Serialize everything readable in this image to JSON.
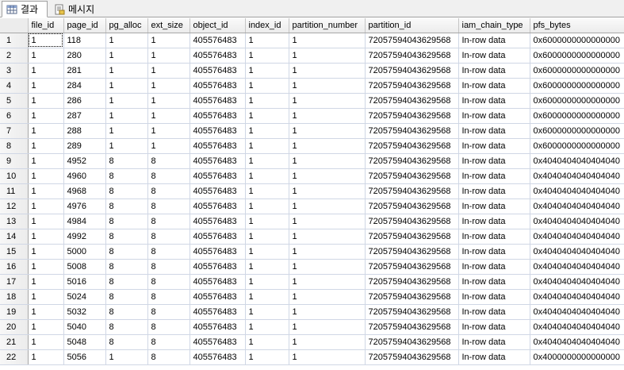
{
  "tabs": [
    {
      "label": "결과",
      "icon": "grid-results-icon",
      "active": true
    },
    {
      "label": "메시지",
      "icon": "messages-icon",
      "active": false
    }
  ],
  "columns": [
    "file_id",
    "page_id",
    "pg_alloc",
    "ext_size",
    "object_id",
    "index_id",
    "partition_number",
    "partition_id",
    "iam_chain_type",
    "pfs_bytes"
  ],
  "rows": [
    {
      "n": "1",
      "cells": [
        "1",
        "118",
        "1",
        "1",
        "405576483",
        "1",
        "1",
        "72057594043629568",
        "In-row data",
        "0x6000000000000000"
      ]
    },
    {
      "n": "2",
      "cells": [
        "1",
        "280",
        "1",
        "1",
        "405576483",
        "1",
        "1",
        "72057594043629568",
        "In-row data",
        "0x6000000000000000"
      ]
    },
    {
      "n": "3",
      "cells": [
        "1",
        "281",
        "1",
        "1",
        "405576483",
        "1",
        "1",
        "72057594043629568",
        "In-row data",
        "0x6000000000000000"
      ]
    },
    {
      "n": "4",
      "cells": [
        "1",
        "284",
        "1",
        "1",
        "405576483",
        "1",
        "1",
        "72057594043629568",
        "In-row data",
        "0x6000000000000000"
      ]
    },
    {
      "n": "5",
      "cells": [
        "1",
        "286",
        "1",
        "1",
        "405576483",
        "1",
        "1",
        "72057594043629568",
        "In-row data",
        "0x6000000000000000"
      ]
    },
    {
      "n": "6",
      "cells": [
        "1",
        "287",
        "1",
        "1",
        "405576483",
        "1",
        "1",
        "72057594043629568",
        "In-row data",
        "0x6000000000000000"
      ]
    },
    {
      "n": "7",
      "cells": [
        "1",
        "288",
        "1",
        "1",
        "405576483",
        "1",
        "1",
        "72057594043629568",
        "In-row data",
        "0x6000000000000000"
      ]
    },
    {
      "n": "8",
      "cells": [
        "1",
        "289",
        "1",
        "1",
        "405576483",
        "1",
        "1",
        "72057594043629568",
        "In-row data",
        "0x6000000000000000"
      ]
    },
    {
      "n": "9",
      "cells": [
        "1",
        "4952",
        "8",
        "8",
        "405576483",
        "1",
        "1",
        "72057594043629568",
        "In-row data",
        "0x4040404040404040"
      ]
    },
    {
      "n": "10",
      "cells": [
        "1",
        "4960",
        "8",
        "8",
        "405576483",
        "1",
        "1",
        "72057594043629568",
        "In-row data",
        "0x4040404040404040"
      ]
    },
    {
      "n": "11",
      "cells": [
        "1",
        "4968",
        "8",
        "8",
        "405576483",
        "1",
        "1",
        "72057594043629568",
        "In-row data",
        "0x4040404040404040"
      ]
    },
    {
      "n": "12",
      "cells": [
        "1",
        "4976",
        "8",
        "8",
        "405576483",
        "1",
        "1",
        "72057594043629568",
        "In-row data",
        "0x4040404040404040"
      ]
    },
    {
      "n": "13",
      "cells": [
        "1",
        "4984",
        "8",
        "8",
        "405576483",
        "1",
        "1",
        "72057594043629568",
        "In-row data",
        "0x4040404040404040"
      ]
    },
    {
      "n": "14",
      "cells": [
        "1",
        "4992",
        "8",
        "8",
        "405576483",
        "1",
        "1",
        "72057594043629568",
        "In-row data",
        "0x4040404040404040"
      ]
    },
    {
      "n": "15",
      "cells": [
        "1",
        "5000",
        "8",
        "8",
        "405576483",
        "1",
        "1",
        "72057594043629568",
        "In-row data",
        "0x4040404040404040"
      ]
    },
    {
      "n": "16",
      "cells": [
        "1",
        "5008",
        "8",
        "8",
        "405576483",
        "1",
        "1",
        "72057594043629568",
        "In-row data",
        "0x4040404040404040"
      ]
    },
    {
      "n": "17",
      "cells": [
        "1",
        "5016",
        "8",
        "8",
        "405576483",
        "1",
        "1",
        "72057594043629568",
        "In-row data",
        "0x4040404040404040"
      ]
    },
    {
      "n": "18",
      "cells": [
        "1",
        "5024",
        "8",
        "8",
        "405576483",
        "1",
        "1",
        "72057594043629568",
        "In-row data",
        "0x4040404040404040"
      ]
    },
    {
      "n": "19",
      "cells": [
        "1",
        "5032",
        "8",
        "8",
        "405576483",
        "1",
        "1",
        "72057594043629568",
        "In-row data",
        "0x4040404040404040"
      ]
    },
    {
      "n": "20",
      "cells": [
        "1",
        "5040",
        "8",
        "8",
        "405576483",
        "1",
        "1",
        "72057594043629568",
        "In-row data",
        "0x4040404040404040"
      ]
    },
    {
      "n": "21",
      "cells": [
        "1",
        "5048",
        "8",
        "8",
        "405576483",
        "1",
        "1",
        "72057594043629568",
        "In-row data",
        "0x4040404040404040"
      ]
    },
    {
      "n": "22",
      "cells": [
        "1",
        "5056",
        "1",
        "8",
        "405576483",
        "1",
        "1",
        "72057594043629568",
        "In-row data",
        "0x4000000000000000"
      ]
    }
  ],
  "selected_cell": {
    "row": 0,
    "col": 0
  }
}
